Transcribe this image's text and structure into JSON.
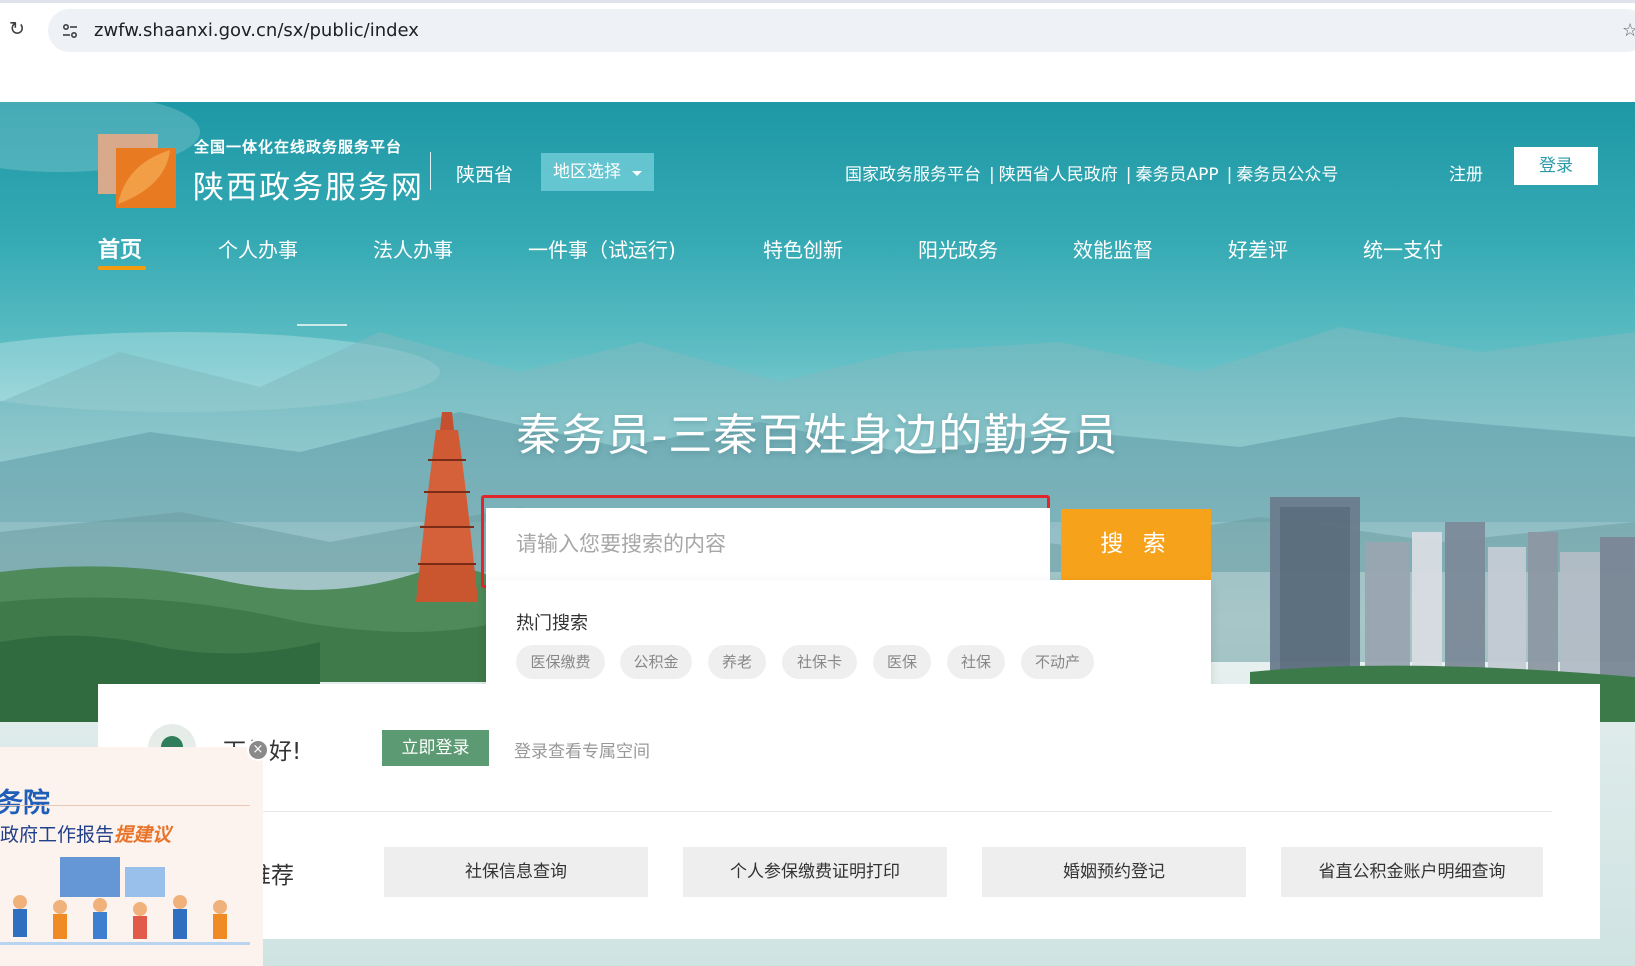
{
  "browser": {
    "url": "zwfw.shaanxi.gov.cn/sx/public/index"
  },
  "header": {
    "platform_slogan": "全国一体化在线政务服务平台",
    "site_name": "陕西政务服务网",
    "province": "陕西省",
    "region_select": "地区选择",
    "top_links": [
      "国家政务服务平台",
      "陕西省人民政府",
      "秦务员APP",
      "秦务员公众号"
    ],
    "register": "注册",
    "login": "登录"
  },
  "nav": {
    "items": [
      "首页",
      "个人办事",
      "法人办事",
      "一件事（试运行)",
      "特色创新",
      "阳光政务",
      "效能监督",
      "好差评",
      "统一支付"
    ]
  },
  "hero": {
    "title": "秦务员-三秦百姓身边的勤务员"
  },
  "search": {
    "placeholder": "请输入您要搜索的内容",
    "button": "搜 索",
    "hot_title": "热门搜索",
    "hot_tags": [
      "医保缴费",
      "公积金",
      "养老",
      "社保卡",
      "医保",
      "社保",
      "不动产"
    ]
  },
  "panel": {
    "greeting": "下午好!",
    "login_now": "立即登录",
    "login_tip": "登录查看专属空间",
    "recommend_label": "推荐",
    "recommend_items": [
      "社保信息查询",
      "个人参保缴费证明打印",
      "婚姻预约登记",
      "省直公积金账户明细查询"
    ]
  },
  "float_ad": {
    "title": "务院",
    "subtitle_prefix": "政府工作报告",
    "subtitle_highlight": "提建议",
    "close": "×"
  },
  "colors": {
    "accent_orange": "#f7a21b",
    "highlight_red": "#e0262c",
    "login_green": "#5b9a72",
    "nav_underline": "#f39c12"
  }
}
